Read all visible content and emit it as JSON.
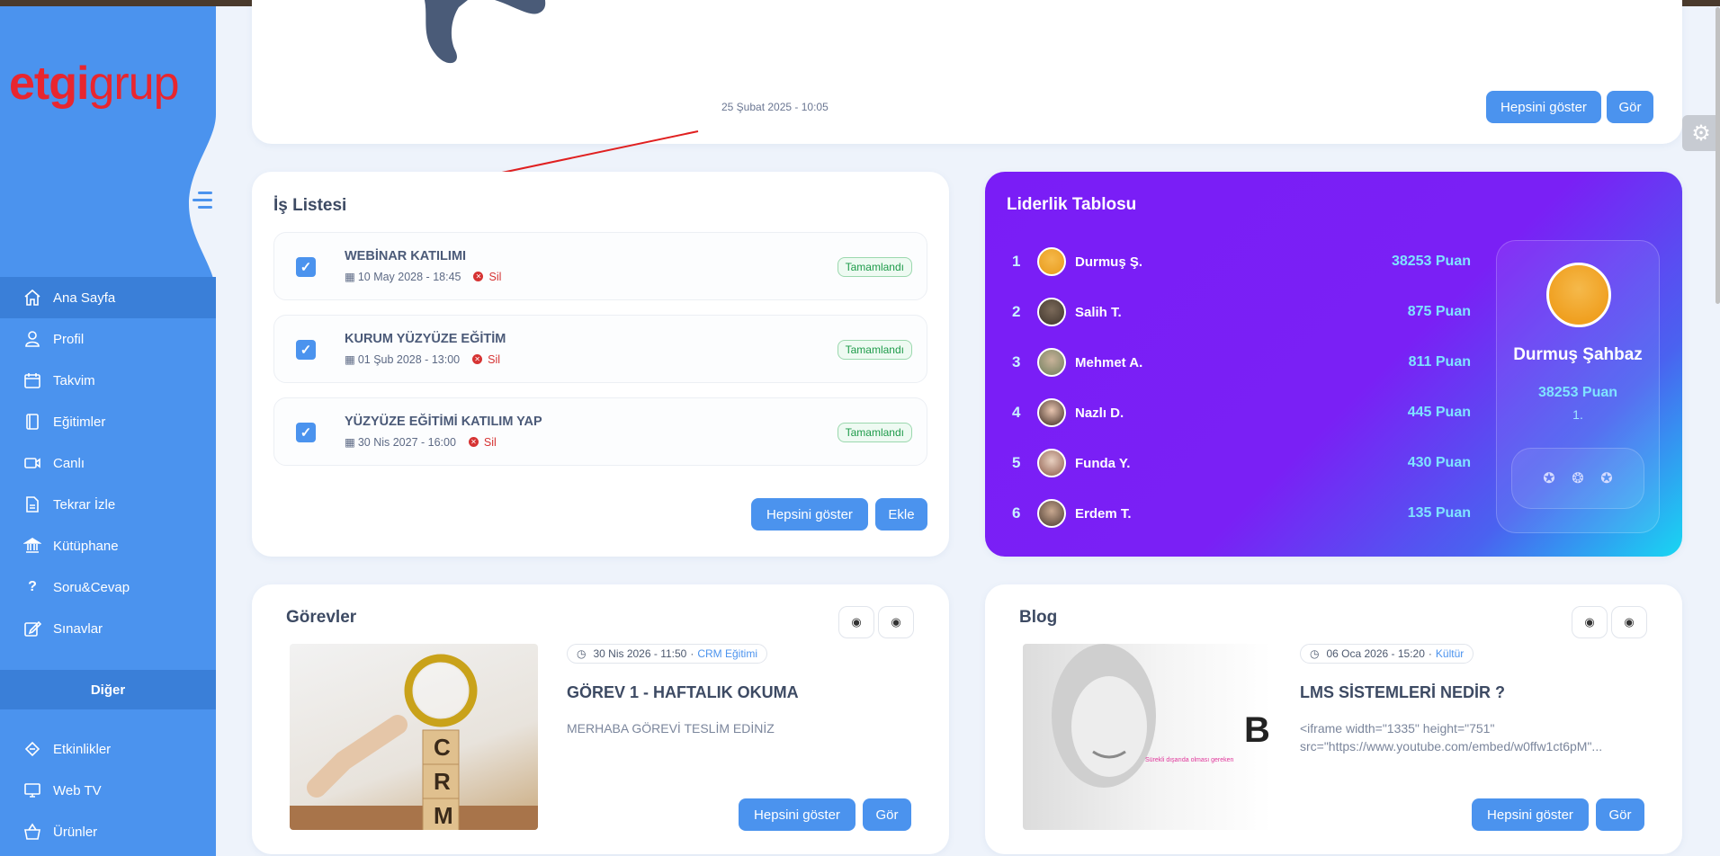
{
  "brand": {
    "logo_a": "etgi",
    "logo_b": "grup"
  },
  "sidebar": {
    "items": [
      {
        "label": "Ana Sayfa",
        "icon": "home-icon"
      },
      {
        "label": "Profil",
        "icon": "user-icon"
      },
      {
        "label": "Takvim",
        "icon": "calendar-icon"
      },
      {
        "label": "Eğitimler",
        "icon": "book-icon"
      },
      {
        "label": "Canlı",
        "icon": "video-icon"
      },
      {
        "label": "Tekrar İzle",
        "icon": "document-icon"
      },
      {
        "label": "Kütüphane",
        "icon": "library-icon"
      },
      {
        "label": "Soru&Cevap",
        "icon": "question-icon"
      },
      {
        "label": "Sınavlar",
        "icon": "edit-icon"
      }
    ],
    "section_label": "Diğer",
    "items2": [
      {
        "label": "Etkinlikler",
        "icon": "ticket-icon"
      },
      {
        "label": "Web TV",
        "icon": "tv-icon"
      },
      {
        "label": "Ürünler",
        "icon": "basket-icon"
      }
    ]
  },
  "top_card": {
    "date": "25 Şubat 2025 - 10:05",
    "show_all": "Hepsini göster",
    "view": "Gör"
  },
  "tasks": {
    "title": "İş Listesi",
    "items": [
      {
        "title": "WEBİNAR KATILIMI",
        "date": "10 May 2028 - 18:45",
        "delete": "Sil",
        "status": "Tamamlandı"
      },
      {
        "title": "KURUM YÜZYÜZE EĞİTİM",
        "date": "01 Şub 2028 - 13:00",
        "delete": "Sil",
        "status": "Tamamlandı"
      },
      {
        "title": "YÜZYÜZE EĞİTİMİ KATILIM YAP",
        "date": "30 Nis 2027 - 16:00",
        "delete": "Sil",
        "status": "Tamamlandı"
      }
    ],
    "show_all": "Hepsini göster",
    "add": "Ekle"
  },
  "leaderboard": {
    "title": "Liderlik Tablosu",
    "rows": [
      {
        "rank": "1",
        "name": "Durmuş Ş.",
        "points": "38253 Puan"
      },
      {
        "rank": "2",
        "name": "Salih T.",
        "points": "875 Puan"
      },
      {
        "rank": "3",
        "name": "Mehmet A.",
        "points": "811 Puan"
      },
      {
        "rank": "4",
        "name": "Nazlı D.",
        "points": "445 Puan"
      },
      {
        "rank": "5",
        "name": "Funda Y.",
        "points": "430 Puan"
      },
      {
        "rank": "6",
        "name": "Erdem T.",
        "points": "135 Puan"
      }
    ],
    "profile": {
      "name": "Durmuş Şahbaz",
      "points": "38253 Puan",
      "rank": "1."
    }
  },
  "gorevler": {
    "title": "Görevler",
    "date": "30 Nis 2026 - 11:50",
    "category": "CRM Eğitimi",
    "post_title": "GÖREV 1 - HAFTALIK OKUMA",
    "body": "MERHABA GÖREVİ TESLİM EDİNİZ",
    "thumb_letters": [
      "C",
      "R",
      "M"
    ],
    "show_all": "Hepsini göster",
    "view": "Gör"
  },
  "blog": {
    "title": "Blog",
    "date": "06 Oca 2026 - 15:20",
    "category": "Kültür",
    "post_title": "LMS SİSTEMLERİ NEDİR ?",
    "body_line1": "<iframe width=\"1335\" height=\"751\"",
    "body_line2": "src=\"https://www.youtube.com/embed/w0ffw1ct6pM\"...",
    "thumb_letter": "B",
    "thumb_caption": "Sürekli dışarıda olması gereken",
    "show_all": "Hepsini göster",
    "view": "Gör"
  },
  "colors": {
    "primary": "#4b93ee",
    "sidebar": "#4b93ee",
    "leader_start": "#7a1df6",
    "leader_end": "#18d7f2",
    "success": "#1e9b4a",
    "danger": "#d63333"
  }
}
